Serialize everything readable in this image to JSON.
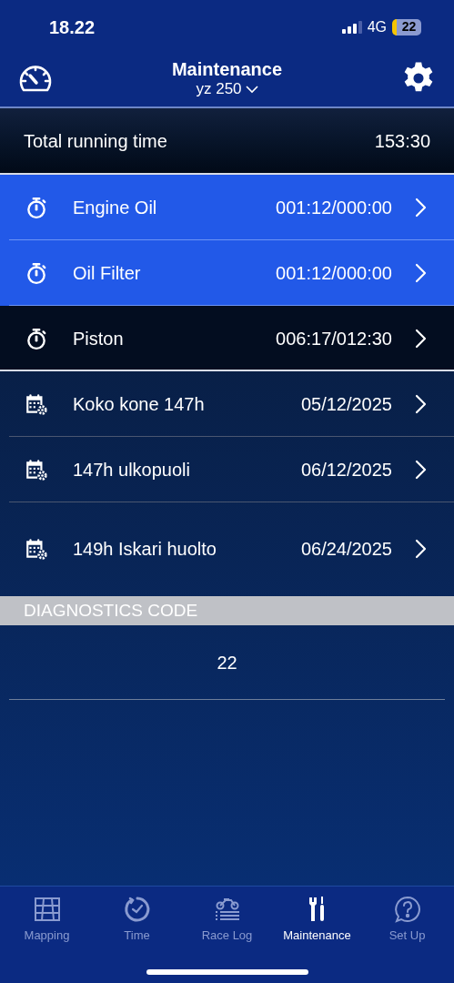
{
  "status_bar": {
    "time": "18.22",
    "network": "4G",
    "battery": "22"
  },
  "header": {
    "title": "Maintenance",
    "subtitle": "yz 250"
  },
  "total": {
    "label": "Total running time",
    "value": "153:30"
  },
  "items": [
    {
      "kind": "timer",
      "label": "Engine Oil",
      "value": "001:12/000:00",
      "highlighted": true
    },
    {
      "kind": "timer",
      "label": "Oil Filter",
      "value": "001:12/000:00",
      "highlighted": true
    },
    {
      "kind": "timer",
      "label": "Piston",
      "value": "006:17/012:30",
      "highlighted": false
    },
    {
      "kind": "calendar",
      "label": "Koko kone 147h",
      "value": "05/12/2025",
      "highlighted": false
    },
    {
      "kind": "calendar",
      "label": "147h ulkopuoli",
      "value": "06/12/2025",
      "highlighted": false
    },
    {
      "kind": "calendar",
      "label": "149h Iskari huolto",
      "value": "06/24/2025",
      "highlighted": false
    }
  ],
  "diagnostics": {
    "heading": "DIAGNOSTICS CODE",
    "code": "22"
  },
  "tabs": [
    {
      "kind": "map",
      "label": "Mapping",
      "selected": false
    },
    {
      "kind": "time",
      "label": "Time",
      "selected": false
    },
    {
      "kind": "bike",
      "label": "Race Log",
      "selected": false
    },
    {
      "kind": "tools",
      "label": "Maintenance",
      "selected": true
    },
    {
      "kind": "help",
      "label": "Set Up",
      "selected": false
    }
  ]
}
